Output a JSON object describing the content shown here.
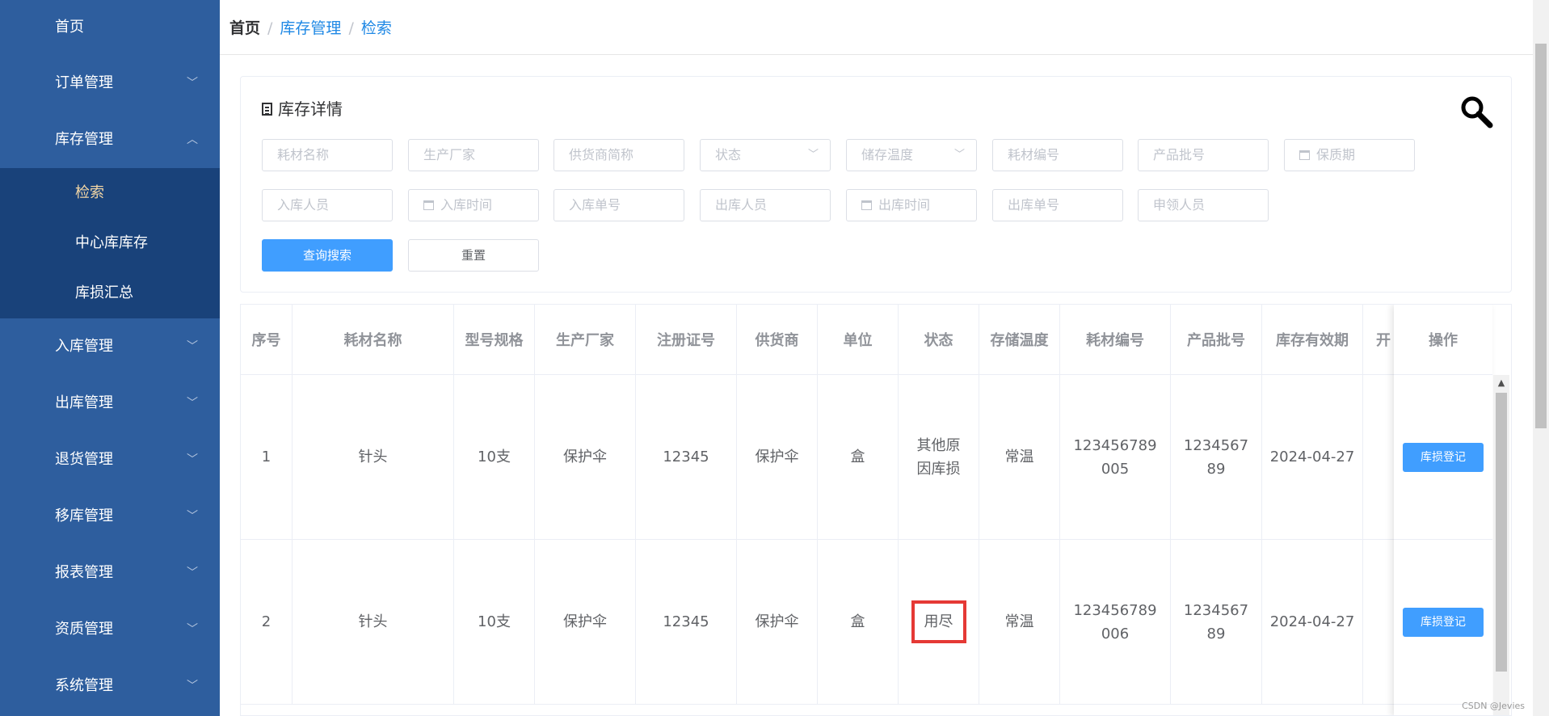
{
  "sidebar": {
    "items": [
      {
        "label": "首页"
      },
      {
        "label": "订单管理"
      },
      {
        "label": "库存管理"
      },
      {
        "label": "入库管理"
      },
      {
        "label": "出库管理"
      },
      {
        "label": "退货管理"
      },
      {
        "label": "移库管理"
      },
      {
        "label": "报表管理"
      },
      {
        "label": "资质管理"
      },
      {
        "label": "系统管理"
      }
    ],
    "submenu": [
      {
        "label": "检索",
        "active": true
      },
      {
        "label": "中心库库存"
      },
      {
        "label": "库损汇总"
      }
    ]
  },
  "breadcrumb": {
    "home": "首页",
    "level1": "库存管理",
    "level2": "检索"
  },
  "panel": {
    "title": "库存详情",
    "fields": {
      "material_name": "耗材名称",
      "manufacturer": "生产厂家",
      "supplier_short": "供货商简称",
      "status": "状态",
      "storage_temp": "储存温度",
      "material_no": "耗材编号",
      "batch_no": "产品批号",
      "shelf_life": "保质期",
      "in_person": "入库人员",
      "in_time": "入库时间",
      "in_no": "入库单号",
      "out_person": "出库人员",
      "out_time": "出库时间",
      "out_no": "出库单号",
      "applicant": "申领人员"
    },
    "search_label": "查询搜索",
    "reset_label": "重置"
  },
  "table": {
    "headers": {
      "seq": "序号",
      "name": "耗材名称",
      "spec": "型号规格",
      "maker": "生产厂家",
      "reg": "注册证号",
      "supplier": "供货商",
      "unit": "单位",
      "status": "状态",
      "temp": "存储温度",
      "code": "耗材编号",
      "batch": "产品批号",
      "expiry": "库存有效期",
      "partial": "开",
      "op": "操作"
    },
    "rows": [
      {
        "seq": "1",
        "name": "针头",
        "spec": "10支",
        "maker": "保护伞",
        "reg": "12345",
        "supplier": "保护伞",
        "unit": "盒",
        "status": "其他原因库损",
        "temp": "常温",
        "code": "123456789005",
        "batch": "123456789",
        "expiry": "2024-04-27",
        "op": "库损登记"
      },
      {
        "seq": "2",
        "name": "针头",
        "spec": "10支",
        "maker": "保护伞",
        "reg": "12345",
        "supplier": "保护伞",
        "unit": "盒",
        "status": "用尽",
        "temp": "常温",
        "code": "123456789006",
        "batch": "123456789",
        "expiry": "2024-04-27",
        "op": "库损登记"
      }
    ]
  },
  "watermark": "CSDN @Jevies",
  "colors": {
    "sidebar": "#2e5e9e",
    "submenu": "#19427a",
    "primary": "#409eff",
    "highlight": "#e53935"
  }
}
